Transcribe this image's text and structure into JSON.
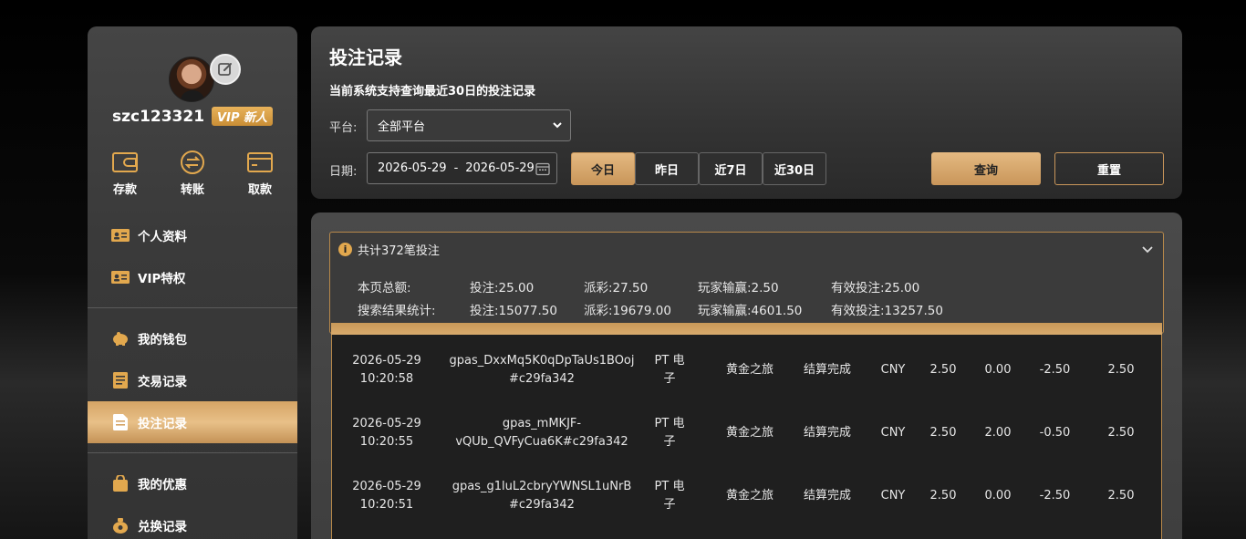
{
  "user": {
    "name": "szc123321",
    "vip_badge": "VIP 新人"
  },
  "quick_actions": [
    {
      "label": "存款",
      "icon": "wallet-icon"
    },
    {
      "label": "转账",
      "icon": "transfer-icon"
    },
    {
      "label": "取款",
      "icon": "card-icon"
    }
  ],
  "menu_group1": [
    {
      "label": "个人资料",
      "icon": "profile-card-icon"
    },
    {
      "label": "VIP特权",
      "icon": "vip-card-icon"
    }
  ],
  "menu_group2": [
    {
      "label": "我的钱包",
      "icon": "piggy-bank-icon"
    },
    {
      "label": "交易记录",
      "icon": "ledger-icon"
    },
    {
      "label": "投注记录",
      "icon": "bet-slip-icon",
      "active": true
    }
  ],
  "menu_group3": [
    {
      "label": "我的优惠",
      "icon": "gift-bag-icon"
    },
    {
      "label": "兑换记录",
      "icon": "money-bag-icon"
    }
  ],
  "filter": {
    "title": "投注记录",
    "subtitle": "当前系统支持查询最近30日的投注记录",
    "platform_label": "平台:",
    "platform_value": "全部平台",
    "date_label": "日期:",
    "date_start": "2026-05-29",
    "date_sep": "-",
    "date_end": "2026-05-29",
    "ranges": [
      "今日",
      "昨日",
      "近7日",
      "近30日"
    ],
    "active_range": "今日",
    "query_label": "查询",
    "reset_label": "重置"
  },
  "summary": {
    "header": "共计372笔投注",
    "page": {
      "label": "本页总额:",
      "bet": "投注:25.00",
      "payout": "派彩:27.50",
      "win_loss": "玩家输赢:2.50",
      "valid_bet": "有效投注:25.00"
    },
    "search": {
      "label": "搜索结果统计:",
      "bet": "投注:15077.50",
      "payout": "派彩:19679.00",
      "win_loss": "玩家输赢:4601.50",
      "valid_bet": "有效投注:13257.50"
    }
  },
  "rows": [
    {
      "date": "2026-05-29",
      "time": "10:20:58",
      "id_line1": "gpas_DxxMq5K0qDpTaUs1BOoj",
      "id_line2": "#c29fa342",
      "platform_line1": "PT 电",
      "platform_line2": "子",
      "game": "黄金之旅",
      "status": "结算完成",
      "currency": "CNY",
      "bet": "2.50",
      "payout": "0.00",
      "win_loss": "-2.50",
      "valid": "2.50"
    },
    {
      "date": "2026-05-29",
      "time": "10:20:55",
      "id_line1": "gpas_mMKJF-",
      "id_line2": "vQUb_QVFyCua6K#c29fa342",
      "platform_line1": "PT 电",
      "platform_line2": "子",
      "game": "黄金之旅",
      "status": "结算完成",
      "currency": "CNY",
      "bet": "2.50",
      "payout": "2.00",
      "win_loss": "-0.50",
      "valid": "2.50"
    },
    {
      "date": "2026-05-29",
      "time": "10:20:51",
      "id_line1": "gpas_g1luL2cbryYWNSL1uNrB",
      "id_line2": "#c29fa342",
      "platform_line1": "PT 电",
      "platform_line2": "子",
      "game": "黄金之旅",
      "status": "结算完成",
      "currency": "CNY",
      "bet": "2.50",
      "payout": "0.00",
      "win_loss": "-2.50",
      "valid": "2.50"
    }
  ],
  "colors": {
    "accent_gold": "#d5a465",
    "panel_bg": "#3e3e3e",
    "table_bg": "#1f1f1f"
  }
}
